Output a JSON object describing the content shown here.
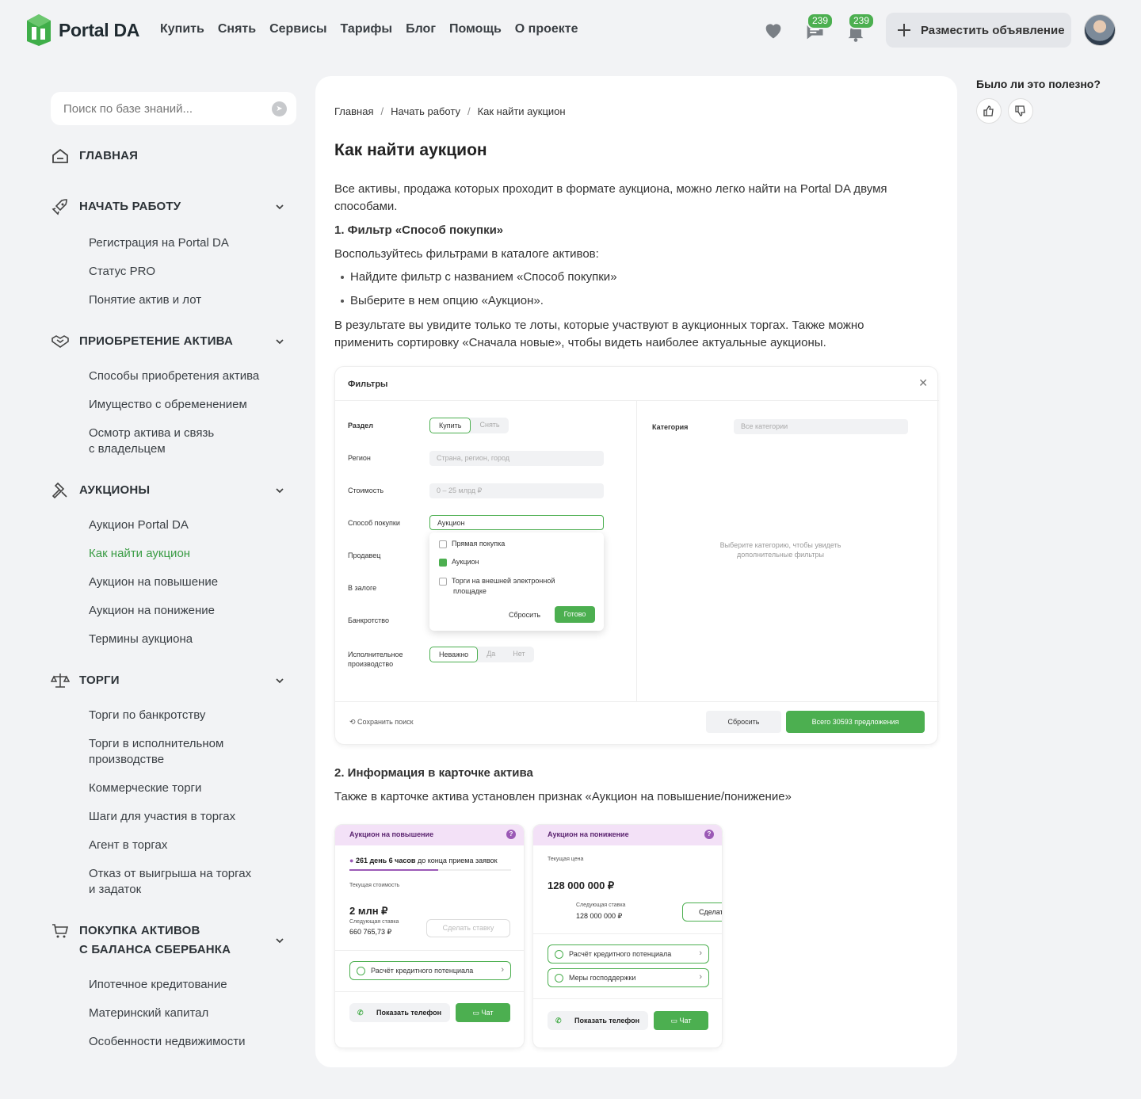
{
  "brand": {
    "name": "Portal DA",
    "accent": "#4caf50"
  },
  "nav": [
    "Купить",
    "Снять",
    "Сервисы",
    "Тарифы",
    "Блог",
    "Помощь",
    "О проекте"
  ],
  "header": {
    "messages_count": "239",
    "notifications_count": "239",
    "post_button": "Разместить объявление"
  },
  "search": {
    "placeholder": "Поиск по базе знаний..."
  },
  "sidebar": {
    "home": "ГЛАВНАЯ",
    "sections": [
      {
        "title": "НАЧАТЬ РАБОТУ",
        "items": [
          "Регистрация на Portal DA",
          "Статус PRO",
          "Понятие актив и лот"
        ]
      },
      {
        "title": "ПРИОБРЕТЕНИЕ АКТИВА",
        "items": [
          "Способы приобретения актива",
          "Имущество с обременением",
          "Осмотр актива и связь",
          "с владельцем"
        ]
      },
      {
        "title": "АУКЦИОНЫ",
        "items": [
          "Аукцион Portal DA",
          "Как найти аукцион",
          "Аукцион на повышение",
          "Аукцион на понижение",
          "Термины аукциона"
        ]
      },
      {
        "title": "ТОРГИ",
        "items": [
          "Торги по банкротству",
          "Торги в исполнительном",
          "производстве",
          "Коммерческие торги",
          "Шаги для участия в торгах",
          "Агент в торгах",
          "Отказ от выигрыша на торгах",
          "и задаток"
        ]
      },
      {
        "title": "ПОКУПКА АКТИВОВ",
        "title2": "С БАЛАНСА СБЕРБАНКА",
        "items": [
          "Ипотечное кредитование",
          "Материнский капитал",
          "Особенности недвижимости"
        ]
      }
    ]
  },
  "breadcrumbs": [
    "Главная",
    "Начать работу",
    "Как найти аукцион"
  ],
  "article": {
    "title": "Как найти аукцион",
    "intro1": "Все активы, продажа которых проходит в формате аукциона, можно легко найти на Portal DA двумя",
    "intro2": "способами.",
    "h_filter": "1. Фильтр «Способ покупки»",
    "p_filter": "Воспользуйтесь фильтрами в каталоге активов:",
    "bullets": [
      "Найдите фильтр с названием «Способ покупки»",
      "Выберите в нем опцию «Аукцион»."
    ],
    "result1": "В результате вы увидите только те лоты, которые участвуют в аукционных торгах. Также можно",
    "result2": "применить сортировку «Сначала новые», чтобы видеть наиболее актуальные аукционы.",
    "h_card": "2. Информация в карточке актива",
    "p_card": "Также в карточке актива установлен признак «Аукцион на повышение/понижение»"
  },
  "filters": {
    "title": "Фильтры",
    "razdel": "Раздел",
    "buy": "Купить",
    "rent": "Снять",
    "region": "Регион",
    "region_ph": "Страна, регион, город",
    "cost": "Стоимость",
    "cost_val": "0 – 25 млрд ₽",
    "method": "Способ покупки",
    "method_val": "Аукцион",
    "seller": "Продавец",
    "pledge": "В залоге",
    "bankrupt": "Банкротство",
    "enforce1": "Исполнительное",
    "enforce2": "производство",
    "enforce_opts": [
      "Неважно",
      "Да",
      "Нет"
    ],
    "options": [
      "Прямая покупка",
      "Аукцион",
      "Торги на внешней электронной",
      "площадке"
    ],
    "reset": "Сбросить",
    "done": "Готово",
    "category": "Категория",
    "category_ph": "Все категории",
    "hint1": "Выберите категорию, чтобы увидеть",
    "hint2": "дополнительные фильтры",
    "save": "Сохранить поиск",
    "reset_all": "Сбросить",
    "total": "Всего 30593 предложения"
  },
  "card_up": {
    "label": "Аукцион на повышение",
    "days": "261 день 6 часов",
    "days_suffix": "до конца приема заявок",
    "progress": 0.55,
    "cur_label": "Текущая стоимость",
    "price": "2 млн ₽",
    "next_label": "Следующая ставка",
    "next": "660 765,73 ₽",
    "bid": "Сделать ставку",
    "credit": "Расчёт кредитного потенциала",
    "phone": "Показать телефон",
    "chat": "Чат"
  },
  "card_down": {
    "label": "Аукцион на понижение",
    "cur_label": "Текущая цена",
    "price": "128 000 000 ₽",
    "next_label": "Следующая ставка",
    "next": "128 000 000 ₽",
    "bid": "Сделать",
    "credit": "Расчёт кредитного потенциала",
    "support": "Меры господдержки",
    "phone": "Показать телефон",
    "chat": "Чат"
  },
  "feedback": {
    "question": "Было ли это полезно?"
  }
}
